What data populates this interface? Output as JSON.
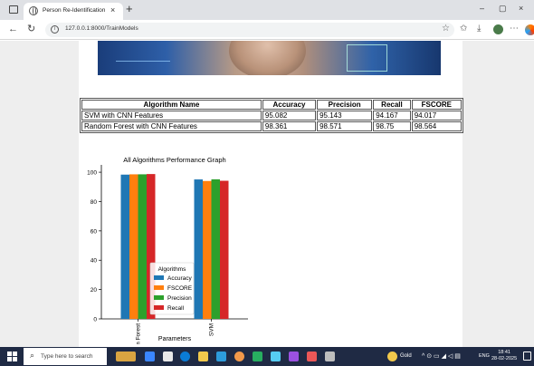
{
  "browser": {
    "tab_title": "Person Re-Identification",
    "tab_close": "×",
    "new_tab": "+",
    "url": "127.0.0.1:8000/TrainModels",
    "window_controls": {
      "minimize": "–",
      "maximize": "▢",
      "close": "×"
    },
    "icons": [
      "back-icon",
      "refresh-icon",
      "info-icon",
      "star-icon",
      "favorites-icon",
      "downloads-icon",
      "profile-icon",
      "more-icon"
    ]
  },
  "results_table": {
    "headers": [
      "Algorithm Name",
      "Accuracy",
      "Precision",
      "Recall",
      "FSCORE"
    ],
    "rows": [
      [
        "SVM with CNN Features",
        "95.082",
        "95.143",
        "94.167",
        "94.017"
      ],
      [
        "Random Forest with CNN Features",
        "98.361",
        "98.571",
        "98.75",
        "98.564"
      ]
    ]
  },
  "chart_data": {
    "type": "bar",
    "title": "All Algorithms Performance Graph",
    "xlabel": "Parameters",
    "ylabel": "",
    "categories": [
      "Random Forest",
      "SVM"
    ],
    "series": [
      {
        "name": "Accuracy",
        "values": [
          98.361,
          95.082
        ],
        "color": "#1f77b4"
      },
      {
        "name": "FSCORE",
        "values": [
          98.564,
          94.017
        ],
        "color": "#ff7f0e"
      },
      {
        "name": "Precision",
        "values": [
          98.571,
          95.143
        ],
        "color": "#2ca02c"
      },
      {
        "name": "Recall",
        "values": [
          98.75,
          94.167
        ],
        "color": "#d62728"
      }
    ],
    "ylim": [
      0,
      105
    ],
    "yticks": [
      0,
      20,
      40,
      60,
      80,
      100
    ],
    "legend_title": "Algorithms",
    "legend_placement": "lower-center",
    "grid": false
  },
  "taskbar": {
    "search_placeholder": "Type here to search",
    "weather": "Gold",
    "language": "ENG",
    "time": "18:41",
    "date": "28-02-2025"
  }
}
